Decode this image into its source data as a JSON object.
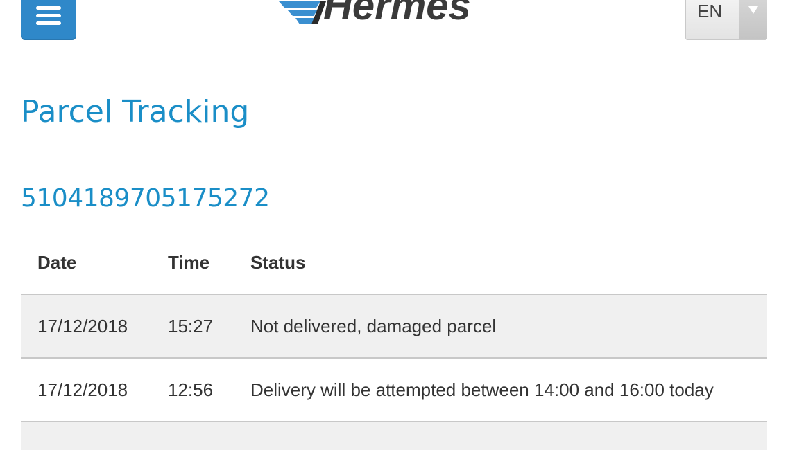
{
  "header": {
    "menu_icon": "hamburger-menu-icon",
    "logo_text": "Hermes",
    "brand_color": "#2f88c9",
    "language": {
      "selected": "EN",
      "arrow_icon": "chevron-down-icon"
    }
  },
  "main": {
    "title": "Parcel Tracking",
    "tracking_number": "5104189705175272",
    "accent_color": "#1a8ec7",
    "table": {
      "headers": {
        "date": "Date",
        "time": "Time",
        "status": "Status"
      },
      "rows": [
        {
          "date": "17/12/2018",
          "time": "15:27",
          "status": "Not delivered, damaged parcel"
        },
        {
          "date": "17/12/2018",
          "time": "12:56",
          "status": "Delivery will be attempted between 14:00 and 16:00 today"
        }
      ]
    }
  }
}
